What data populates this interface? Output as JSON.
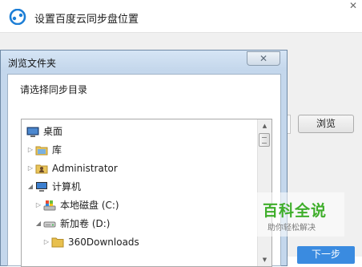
{
  "main_window": {
    "title": "设置百度云同步盘位置",
    "close_glyph": "✕",
    "browse_label": "浏览",
    "next_label": "下一步",
    "brand_color": "#1c7ed6"
  },
  "dialog": {
    "title": "浏览文件夹",
    "close_glyph": "✕",
    "prompt": "请选择同步目录",
    "tree": [
      {
        "label": "桌面",
        "icon": "desktop-icon",
        "level": 0,
        "expander": ""
      },
      {
        "label": "库",
        "icon": "library-folder-icon",
        "level": 0,
        "expander": "collapsed"
      },
      {
        "label": "Administrator",
        "icon": "user-folder-icon",
        "level": 0,
        "expander": "collapsed"
      },
      {
        "label": "计算机",
        "icon": "computer-icon",
        "level": 0,
        "expander": "expanded"
      },
      {
        "label": "本地磁盘 (C:)",
        "icon": "system-drive-icon",
        "level": 1,
        "expander": "collapsed"
      },
      {
        "label": "新加卷 (D:)",
        "icon": "hard-drive-icon",
        "level": 1,
        "expander": "expanded"
      },
      {
        "label": "360Downloads",
        "icon": "folder-icon",
        "level": 2,
        "expander": "collapsed"
      }
    ]
  },
  "watermark": {
    "main_text": "百科全说",
    "sub_text": "助你轻松解决",
    "color": "#3fae2b"
  }
}
